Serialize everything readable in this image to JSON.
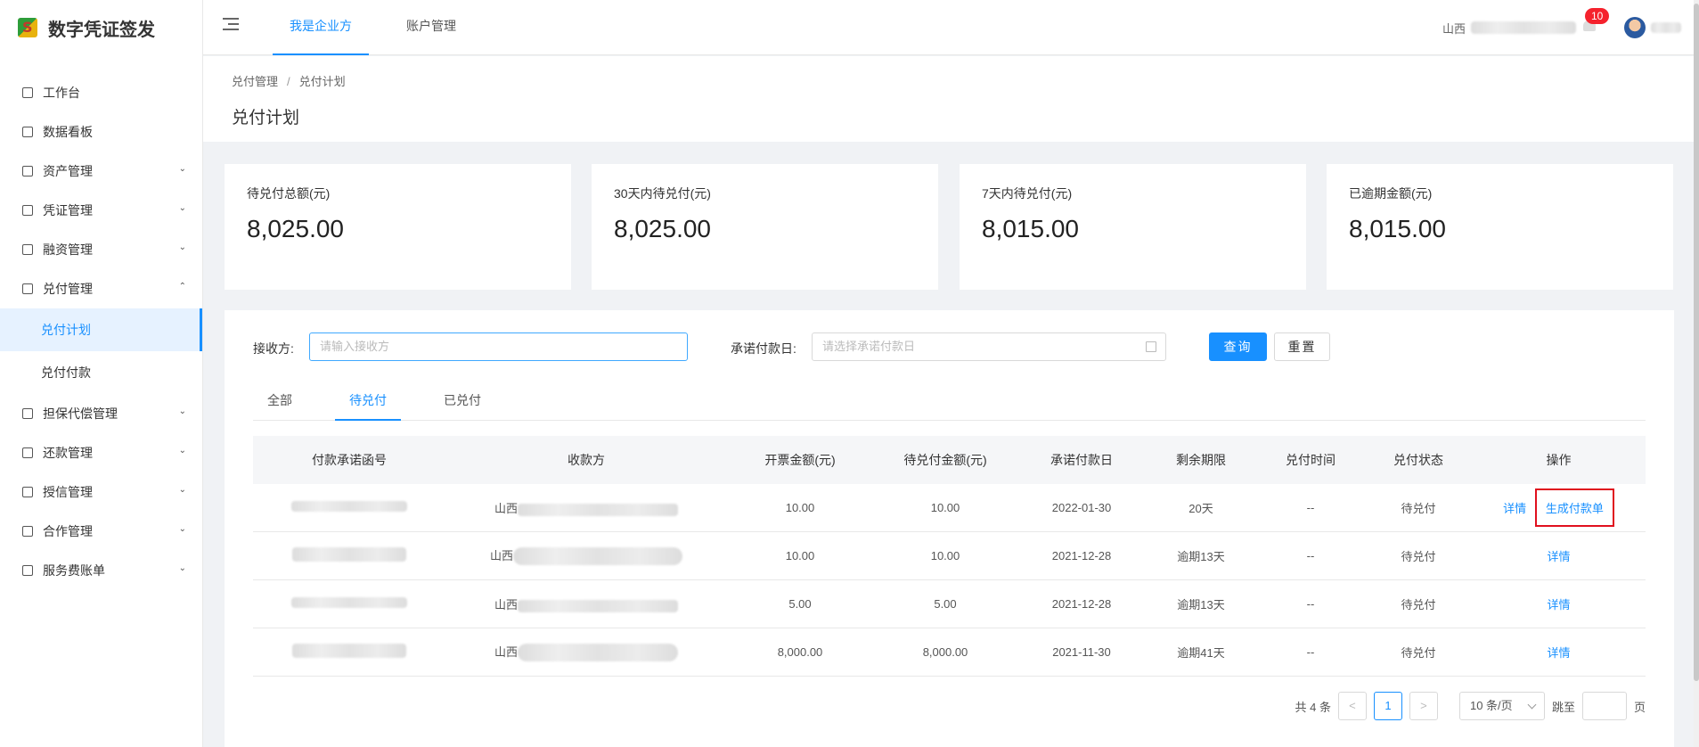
{
  "app": {
    "name": "数字凭证签发"
  },
  "sidebar": {
    "items": [
      {
        "label": "工作台",
        "icon": "monitor-icon",
        "has_children": false
      },
      {
        "label": "数据看板",
        "icon": "chart-icon",
        "has_children": false
      },
      {
        "label": "资产管理",
        "icon": "database-icon",
        "has_children": true
      },
      {
        "label": "凭证管理",
        "icon": "document-icon",
        "has_children": true
      },
      {
        "label": "融资管理",
        "icon": "money-bag-icon",
        "has_children": true
      },
      {
        "label": "兑付管理",
        "icon": "calendar-icon",
        "has_children": true,
        "expanded": true,
        "children": [
          {
            "label": "兑付计划",
            "active": true
          },
          {
            "label": "兑付付款"
          }
        ]
      },
      {
        "label": "担保代偿管理",
        "icon": "truck-icon",
        "has_children": true
      },
      {
        "label": "还款管理",
        "icon": "refresh-icon",
        "has_children": true
      },
      {
        "label": "授信管理",
        "icon": "briefcase-icon",
        "has_children": true
      },
      {
        "label": "合作管理",
        "icon": "users-icon",
        "has_children": true
      },
      {
        "label": "服务费账单",
        "icon": "bill-icon",
        "has_children": true
      }
    ]
  },
  "header": {
    "tabs": [
      {
        "label": "我是企业方",
        "active": true
      },
      {
        "label": "账户管理"
      }
    ],
    "company_prefix": "山西",
    "notification_count": "10"
  },
  "breadcrumb": {
    "parent": "兑付管理",
    "separator": "/",
    "current": "兑付计划"
  },
  "page_title": "兑付计划",
  "stats": [
    {
      "label": "待兑付总额(元)",
      "value": "8,025.00"
    },
    {
      "label": "30天内待兑付(元)",
      "value": "8,025.00"
    },
    {
      "label": "7天内待兑付(元)",
      "value": "8,015.00"
    },
    {
      "label": "已逾期金额(元)",
      "value": "8,015.00"
    }
  ],
  "filters": {
    "receiver_label": "接收方:",
    "receiver_placeholder": "请输入接收方",
    "date_label": "承诺付款日:",
    "date_placeholder": "请选择承诺付款日",
    "query_label": "查询",
    "reset_label": "重置"
  },
  "tabs": [
    {
      "label": "全部"
    },
    {
      "label": "待兑付",
      "active": true
    },
    {
      "label": "已兑付"
    }
  ],
  "table": {
    "columns": [
      "付款承诺函号",
      "收款方",
      "开票金额(元)",
      "待兑付金额(元)",
      "承诺付款日",
      "剩余期限",
      "兑付时间",
      "兑付状态",
      "操作"
    ],
    "rows": [
      {
        "payee_prefix": "山西",
        "invoice_amount": "10.00",
        "pending_amount": "10.00",
        "promise_date": "2022-01-30",
        "remaining": "20天",
        "paid_time": "--",
        "status": "待兑付",
        "actions": [
          "详情",
          "生成付款单"
        ]
      },
      {
        "payee_prefix": "山西",
        "invoice_amount": "10.00",
        "pending_amount": "10.00",
        "promise_date": "2021-12-28",
        "remaining": "逾期13天",
        "paid_time": "--",
        "status": "待兑付",
        "actions": [
          "详情"
        ]
      },
      {
        "payee_prefix": "山西",
        "invoice_amount": "5.00",
        "pending_amount": "5.00",
        "promise_date": "2021-12-28",
        "remaining": "逾期13天",
        "paid_time": "--",
        "status": "待兑付",
        "actions": [
          "详情"
        ]
      },
      {
        "payee_prefix": "山西",
        "invoice_amount": "8,000.00",
        "pending_amount": "8,000.00",
        "promise_date": "2021-11-30",
        "remaining": "逾期41天",
        "paid_time": "--",
        "status": "待兑付",
        "actions": [
          "详情"
        ]
      }
    ]
  },
  "pagination": {
    "total_text": "共 4 条",
    "prev": "<",
    "current_page": "1",
    "next": ">",
    "page_size": "10 条/页",
    "jump_label": "跳至",
    "page_suffix": "页"
  },
  "colors": {
    "primary": "#1890ff",
    "highlight_box": "#e0101e",
    "badge": "#f5222d"
  }
}
